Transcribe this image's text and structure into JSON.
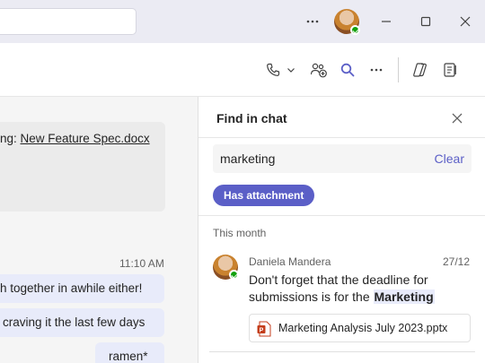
{
  "titlebar": {
    "search_placeholder": "",
    "more_icon": "more-horizontal-icon",
    "avatar_status": "available",
    "window_controls": [
      "minimize-icon",
      "maximize-icon",
      "close-icon"
    ]
  },
  "headerbar": {
    "icons": [
      "phone-icon",
      "chevron-down-icon",
      "add-people-icon",
      "search-icon",
      "more-horizontal-icon",
      "copilot-icon",
      "notes-icon"
    ],
    "accent": "#5b5fc7"
  },
  "chat": {
    "card_prefix": "ng: ",
    "card_link": "New Feature Spec.docx",
    "timestamp": "11:10 AM",
    "bubbles": [
      "h together in awhile either!",
      "craving it the last few days",
      "ramen*"
    ]
  },
  "find_panel": {
    "title": "Find in chat",
    "query": "marketing",
    "clear_label": "Clear",
    "filter_chip": "Has attachment",
    "section_label": "This month",
    "result": {
      "sender": "Daniela Mandera",
      "date": "27/12",
      "text_before": "Don't forget that the deadline for submissions is for the ",
      "text_highlight": "Marketing",
      "attachment": {
        "name": "Marketing Analysis July 2023.pptx",
        "icon": "powerpoint-file-icon",
        "icon_color": "#c43e1c"
      }
    }
  }
}
